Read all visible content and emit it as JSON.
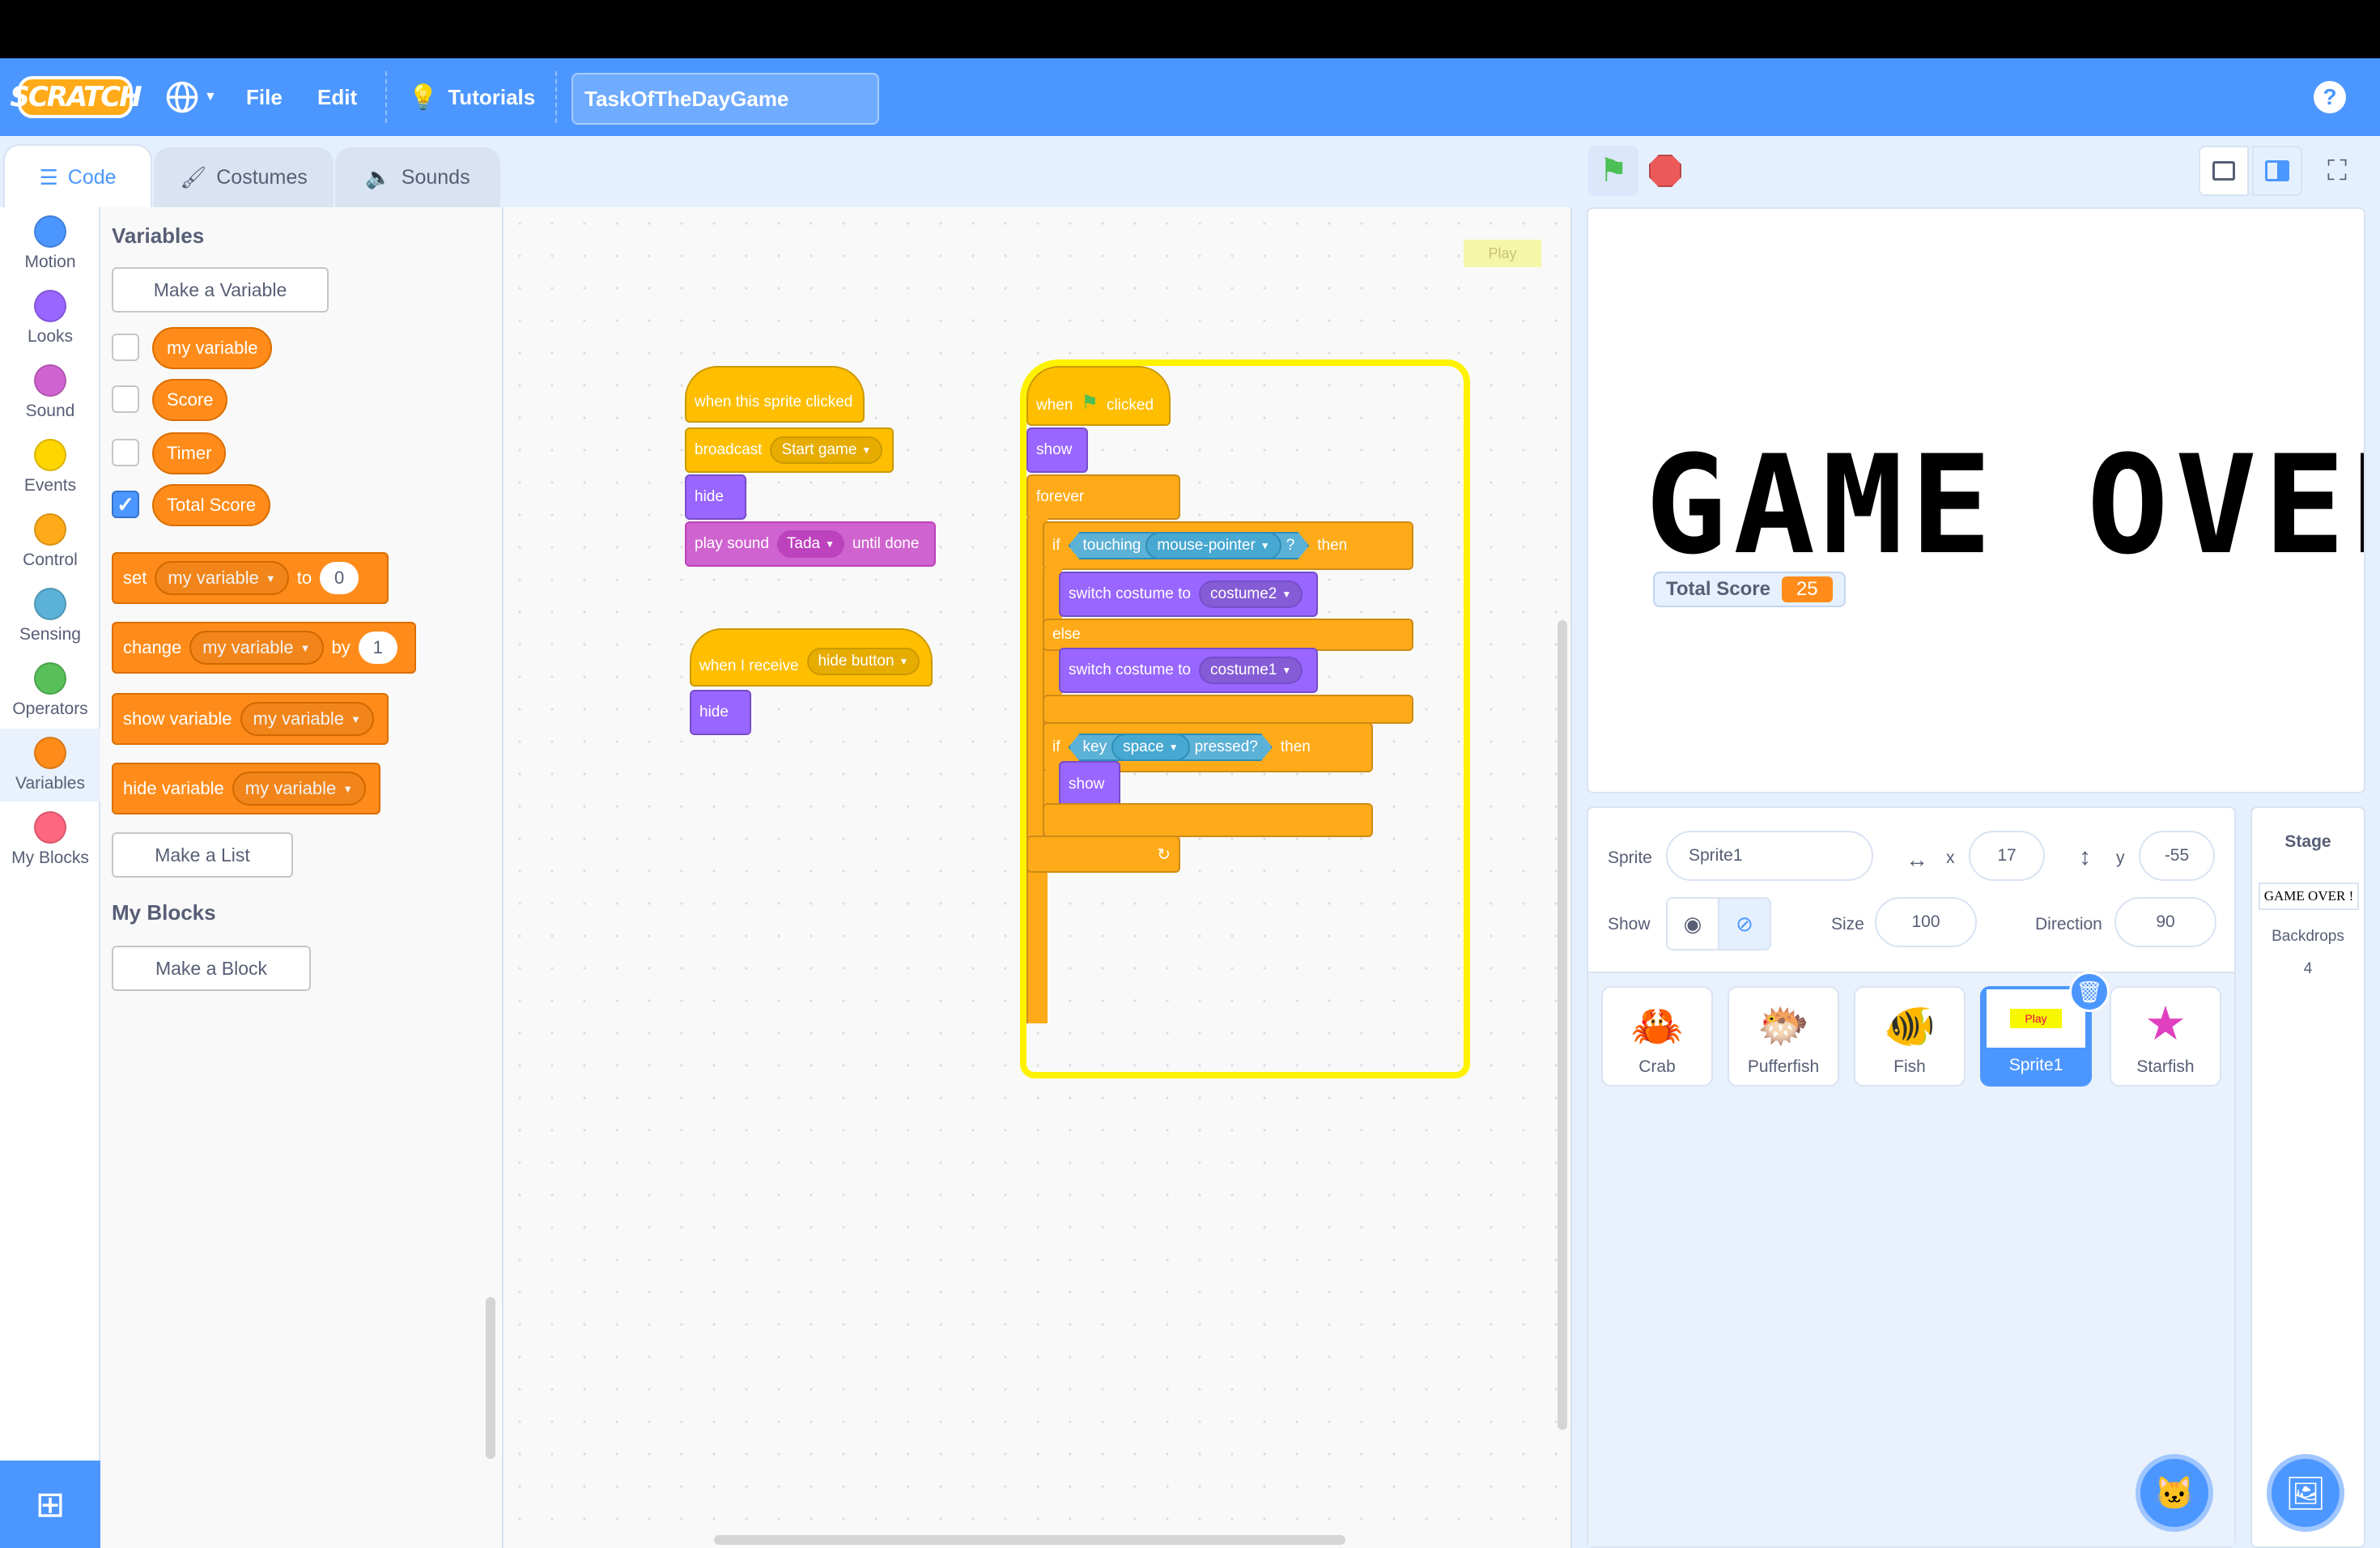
{
  "menu": {
    "file": "File",
    "edit": "Edit",
    "tutorials": "Tutorials",
    "project_title": "TaskOfTheDayGame",
    "logo": "SCRATCH",
    "help": "?"
  },
  "tabs": {
    "code": "Code",
    "costumes": "Costumes",
    "sounds": "Sounds"
  },
  "categories": [
    {
      "label": "Motion",
      "color": "#4c97ff"
    },
    {
      "label": "Looks",
      "color": "#9966ff"
    },
    {
      "label": "Sound",
      "color": "#cf63cf"
    },
    {
      "label": "Events",
      "color": "#ffd500"
    },
    {
      "label": "Control",
      "color": "#ffab19"
    },
    {
      "label": "Sensing",
      "color": "#5cb1d6"
    },
    {
      "label": "Operators",
      "color": "#59c059"
    },
    {
      "label": "Variables",
      "color": "#ff8c1a"
    },
    {
      "label": "My Blocks",
      "color": "#ff6680"
    }
  ],
  "palette": {
    "variables_title": "Variables",
    "make_variable": "Make a Variable",
    "vars": [
      {
        "name": "my variable",
        "checked": false
      },
      {
        "name": "Score",
        "checked": false
      },
      {
        "name": "Timer",
        "checked": false
      },
      {
        "name": "Total Score",
        "checked": true
      }
    ],
    "set_block": {
      "verb": "set",
      "var": "my variable",
      "prep": "to",
      "value": "0"
    },
    "change_block": {
      "verb": "change",
      "var": "my variable",
      "prep": "by",
      "value": "1"
    },
    "show_var": {
      "verb": "show variable",
      "var": "my variable"
    },
    "hide_var": {
      "verb": "hide variable",
      "var": "my variable"
    },
    "make_list": "Make a List",
    "myblocks_title": "My Blocks",
    "make_block": "Make a Block"
  },
  "script1": {
    "hat": "when this sprite clicked",
    "broadcast": "broadcast",
    "broadcast_msg": "Start game",
    "hide": "hide",
    "play": "play sound",
    "sound": "Tada",
    "until": "until done"
  },
  "script2": {
    "hat": "when I receive",
    "msg": "hide button",
    "hide": "hide"
  },
  "script3": {
    "hat_when": "when",
    "hat_clicked": "clicked",
    "show": "show",
    "forever": "forever",
    "if": "if",
    "touching": "touching",
    "target": "mouse-pointer",
    "q": "?",
    "then": "then",
    "switch": "switch costume to",
    "costume2": "costume2",
    "else": "else",
    "costume1": "costume1",
    "key": "key",
    "keyname": "space",
    "pressed": "pressed?",
    "show2": "show"
  },
  "workspace_label": "Play",
  "stage": {
    "text": "GAME OVER !",
    "monitor_label": "Total Score",
    "monitor_value": "25"
  },
  "sprite_info": {
    "sprite_label": "Sprite",
    "sprite_name": "Sprite1",
    "x_label": "x",
    "x": "17",
    "y_label": "y",
    "y": "-55",
    "show_label": "Show",
    "size_label": "Size",
    "size": "100",
    "direction_label": "Direction",
    "direction": "90"
  },
  "sprites": [
    {
      "name": "Crab",
      "icon": "crab-icon"
    },
    {
      "name": "Pufferfish",
      "icon": "pufferfish-icon"
    },
    {
      "name": "Fish",
      "icon": "fish-icon"
    },
    {
      "name": "Sprite1",
      "icon": "play-button-thumbnail",
      "selected": true,
      "thumb_text": "Play"
    },
    {
      "name": "Starfish",
      "icon": "starfish-icon"
    }
  ],
  "stage_pane": {
    "title": "Stage",
    "thumb_text": "GAME OVER !",
    "backdrops_label": "Backdrops",
    "backdrops_count": "4"
  }
}
